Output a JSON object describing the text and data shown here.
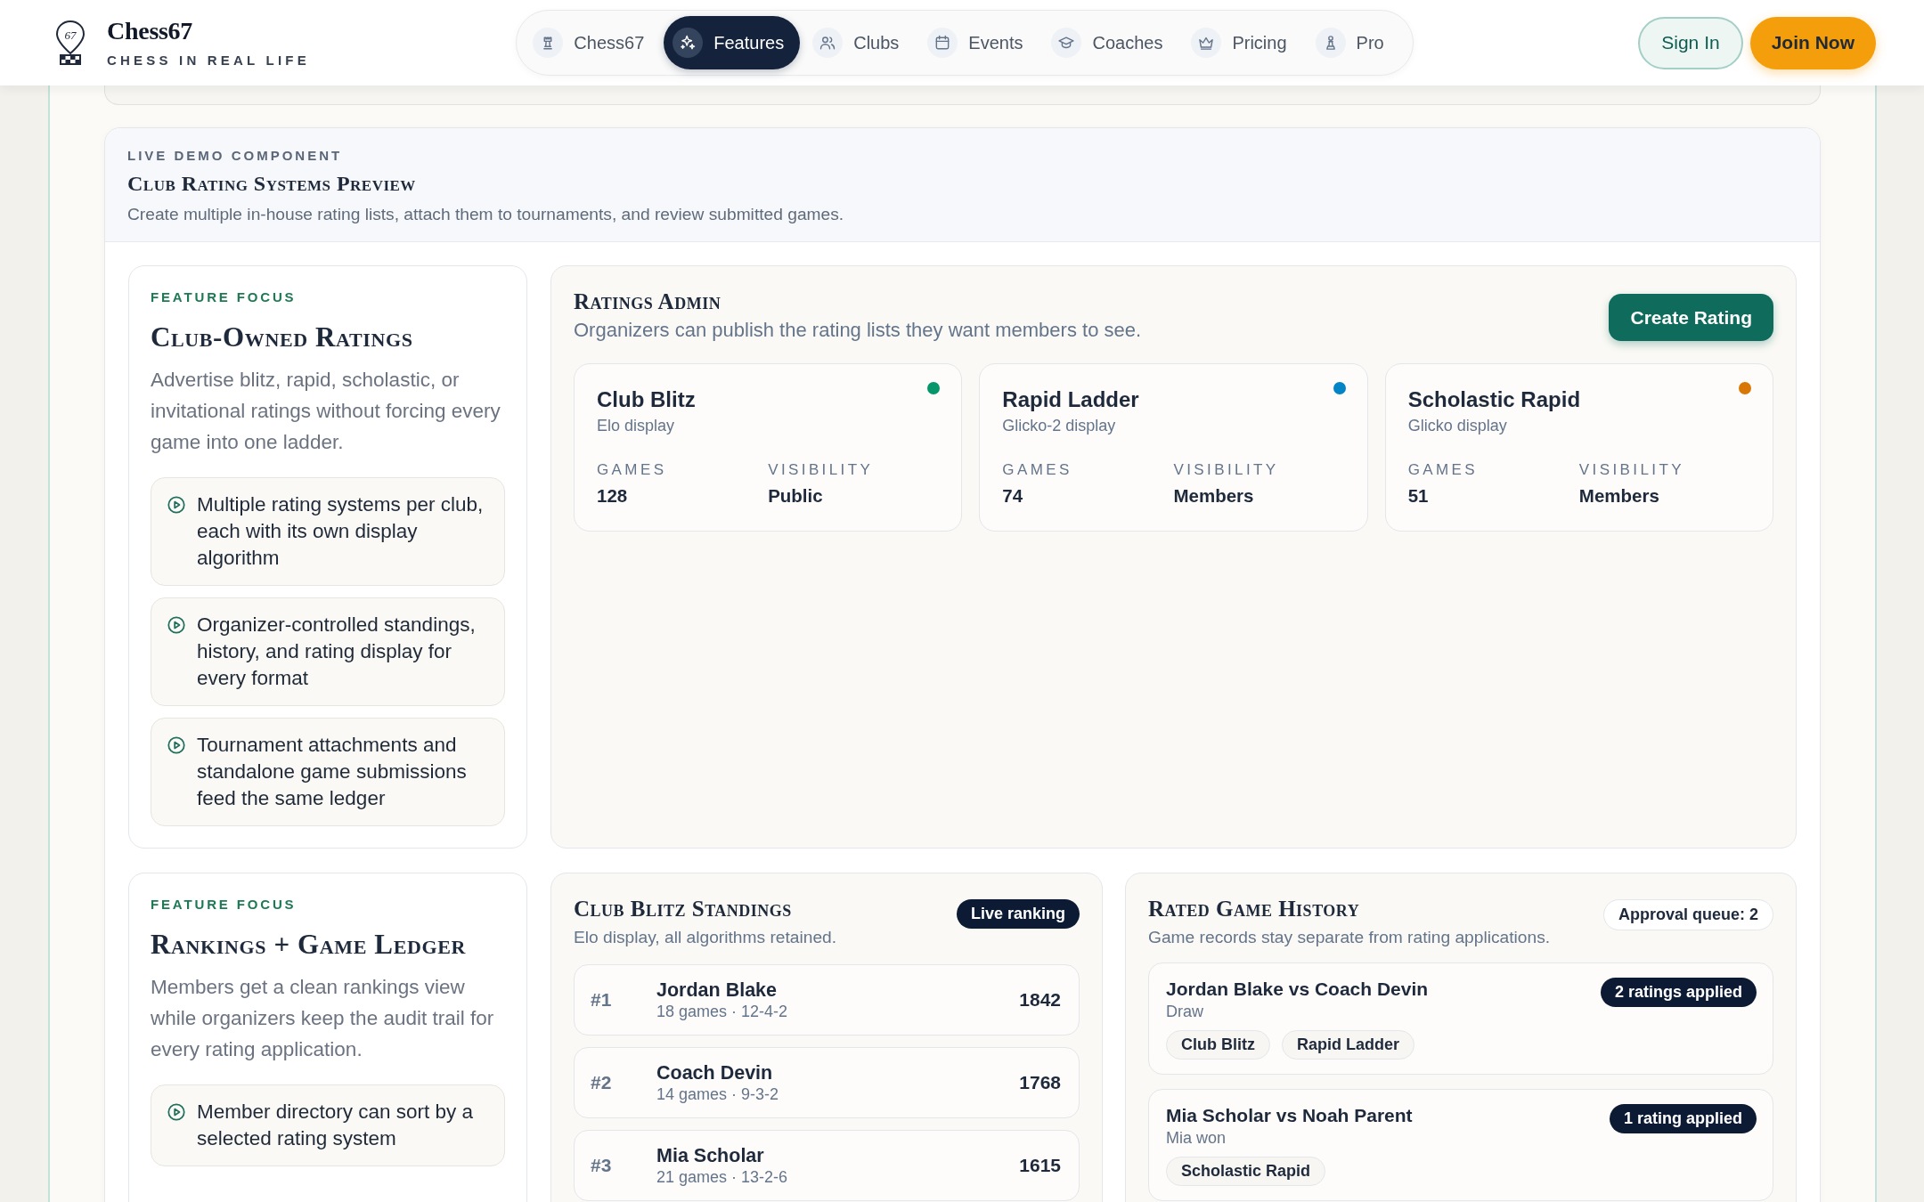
{
  "header": {
    "brand": {
      "logo_mark": "67",
      "name": "Chess67",
      "tagline": "CHESS IN REAL LIFE"
    },
    "nav": [
      {
        "label": "Chess67",
        "selected": false
      },
      {
        "label": "Features",
        "selected": true
      },
      {
        "label": "Clubs",
        "selected": false
      },
      {
        "label": "Events",
        "selected": false
      },
      {
        "label": "Coaches",
        "selected": false
      },
      {
        "label": "Pricing",
        "selected": false
      },
      {
        "label": "Pro",
        "selected": false
      }
    ],
    "actions": [
      {
        "label": "Sign In",
        "kind": "outline"
      },
      {
        "label": "Join Now",
        "kind": "solid"
      }
    ]
  },
  "demo": {
    "eyebrow": "LIVE DEMO COMPONENT",
    "title": "Club Rating Systems Preview",
    "subtitle": "Create multiple in-house rating lists, attach them to tournaments, and review submitted games.",
    "features": [
      {
        "eyebrow": "FEATURE FOCUS",
        "title": "Club-Owned Ratings",
        "text": "Advertise blitz, rapid, scholastic, or invitational ratings without forcing every game into one ladder.",
        "points": [
          "Multiple rating systems per club, each with its own display algorithm",
          "Organizer-controlled standings, history, and rating display for every format",
          "Tournament attachments and standalone game submissions feed the same ledger"
        ]
      },
      {
        "eyebrow": "FEATURE FOCUS",
        "title": "Rankings + Game Ledger",
        "text": "Members get a clean rankings view while organizers keep the audit trail for every rating application.",
        "points": [
          "Member directory can sort by a selected rating system"
        ]
      }
    ],
    "ratings_admin": {
      "title": "Ratings Admin",
      "subtitle": "Organizers can publish the rating lists they want members to see.",
      "button": "Create Rating",
      "ratings": [
        {
          "name": "Club Blitz",
          "algorithm": "Elo display",
          "color": "#059669",
          "stats": [
            {
              "label": "GAMES",
              "value": "128"
            },
            {
              "label": "VISIBILITY",
              "value": "Public"
            }
          ]
        },
        {
          "name": "Rapid Ladder",
          "algorithm": "Glicko-2 display",
          "color": "#0284c7",
          "stats": [
            {
              "label": "GAMES",
              "value": "74"
            },
            {
              "label": "VISIBILITY",
              "value": "Members"
            }
          ]
        },
        {
          "name": "Scholastic Rapid",
          "algorithm": "Glicko display",
          "color": "#d97706",
          "stats": [
            {
              "label": "GAMES",
              "value": "51"
            },
            {
              "label": "VISIBILITY",
              "value": "Members"
            }
          ]
        }
      ]
    },
    "standings": {
      "title": "Club Blitz Standings",
      "subtitle": "Elo display, all algorithms retained.",
      "badge": "Live ranking",
      "rows": [
        {
          "rank": "#1",
          "name": "Jordan Blake",
          "record": "18 games · 12-4-2",
          "rating": "1842"
        },
        {
          "rank": "#2",
          "name": "Coach Devin",
          "record": "14 games · 9-3-2",
          "rating": "1768"
        },
        {
          "rank": "#3",
          "name": "Mia Scholar",
          "record": "21 games · 13-2-6",
          "rating": "1615"
        }
      ]
    },
    "history": {
      "title": "Rated Game History",
      "subtitle": "Game records stay separate from rating applications.",
      "queue": "Approval queue: 2",
      "games": [
        {
          "title": "Jordan Blake vs Coach Devin",
          "result": "Draw",
          "badge": "2 ratings applied",
          "tags": [
            "Club Blitz",
            "Rapid Ladder"
          ]
        },
        {
          "title": "Mia Scholar vs Noah Parent",
          "result": "Mia won",
          "badge": "1 rating applied",
          "tags": [
            "Scholastic Rapid"
          ]
        }
      ]
    }
  }
}
